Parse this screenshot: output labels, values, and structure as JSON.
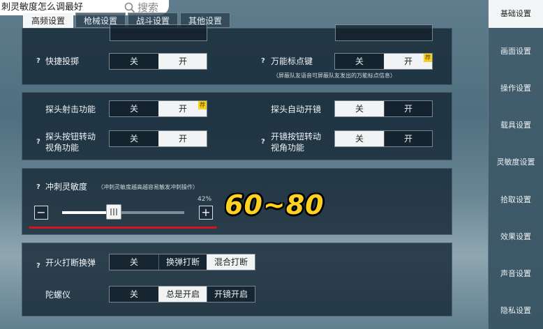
{
  "header": {
    "title": "刺灵敏度怎么调最好",
    "search_placeholder": "搜索"
  },
  "tabs": [
    {
      "label": "高频设置",
      "active": true
    },
    {
      "label": "枪械设置",
      "active": false
    },
    {
      "label": "战斗设置",
      "active": false
    },
    {
      "label": "其他设置",
      "active": false
    }
  ],
  "sidebar": {
    "items": [
      {
        "label": "基础设置",
        "active": true
      },
      {
        "label": "画面设置",
        "active": false
      },
      {
        "label": "操作设置",
        "active": false
      },
      {
        "label": "载具设置",
        "active": false
      },
      {
        "label": "灵敏度设置",
        "active": false
      },
      {
        "label": "拾取设置",
        "active": false
      },
      {
        "label": "效果设置",
        "active": false
      },
      {
        "label": "声音设置",
        "active": false
      },
      {
        "label": "隐私设置",
        "active": false
      }
    ]
  },
  "settings": {
    "quick_throw": {
      "label": "快捷投掷",
      "off": "关",
      "on": "开",
      "selected": "on"
    },
    "marker_key": {
      "label": "万能标点键",
      "off": "关",
      "on": "开",
      "selected": "on",
      "badge": "荐",
      "note": "（屏蔽队友语音可屏蔽队友发出的万能标点信息）"
    },
    "peek_fire": {
      "label": "探头射击功能",
      "off": "关",
      "on": "开",
      "selected": "on",
      "badge": "荐"
    },
    "peek_auto_scope": {
      "label": "探头自动开镜",
      "off": "关",
      "on": "开",
      "selected": "off"
    },
    "peek_rotate_l1": "探头按钮转动",
    "peek_rotate_l2": "视角功能",
    "peek_rotate": {
      "off": "关",
      "on": "开",
      "selected": "on"
    },
    "scope_rotate_l1": "开镜按钮转动",
    "scope_rotate_l2": "视角功能",
    "scope_rotate": {
      "off": "关",
      "on": "开",
      "selected": "off"
    },
    "sprint_sensitivity": {
      "label": "冲刺灵敏度",
      "note": "（冲刺灵敏度越高越容易触发冲刺操作）",
      "percent_label": "42%",
      "value": 0.42,
      "minus": "−",
      "plus": "+"
    },
    "overlay_text": "60~80",
    "fire_interrupt": {
      "label": "开火打断换弹",
      "opt1": "关",
      "opt2": "换弹打断",
      "opt3": "混合打断",
      "selected": 3
    },
    "gyro": {
      "label": "陀螺仪",
      "opt1": "关",
      "opt2": "总是开启",
      "opt3": "开镜开启",
      "selected": 2
    }
  },
  "help_mark": "?",
  "colors": {
    "accent_red": "#d4161c",
    "overlay_yellow": "#ffd21f",
    "badge_yellow": "#f2d21a"
  },
  "icons": [
    "search-icon",
    "help-icon",
    "recommend-badge",
    "slider-thumb-grip"
  ]
}
